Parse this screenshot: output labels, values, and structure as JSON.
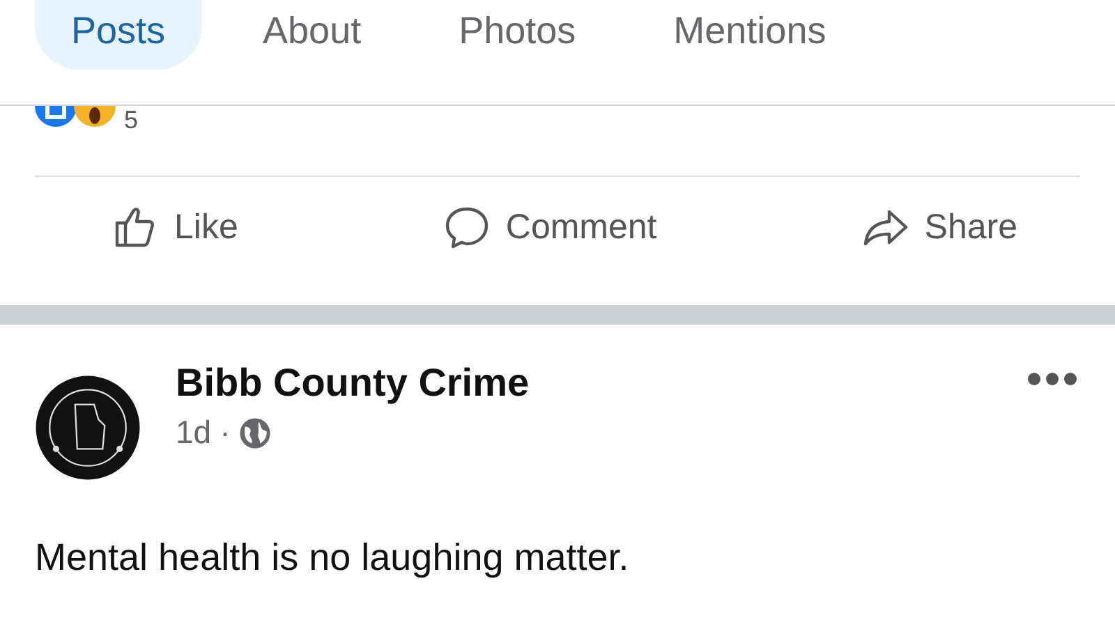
{
  "tabs": [
    {
      "label": "Posts",
      "selected": true
    },
    {
      "label": "About",
      "selected": false
    },
    {
      "label": "Photos",
      "selected": false
    },
    {
      "label": "Mentions",
      "selected": false
    }
  ],
  "previous_post": {
    "reaction_count": "5",
    "actions": [
      {
        "kind": "like",
        "label": "Like"
      },
      {
        "kind": "comment",
        "label": "Comment"
      },
      {
        "kind": "share",
        "label": "Share"
      }
    ]
  },
  "post": {
    "author": "Bibb County Crime",
    "time": "1d",
    "separator": "·",
    "text": "Mental health is no laughing matter."
  }
}
